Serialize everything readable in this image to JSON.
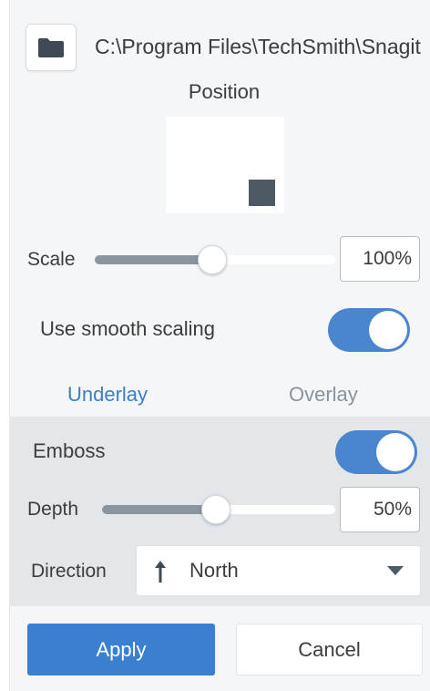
{
  "path": {
    "text": "C:\\Program Files\\TechSmith\\Snagit",
    "icon": "folder-icon"
  },
  "position": {
    "label": "Position",
    "selected": "bottom-right"
  },
  "scale": {
    "label": "Scale",
    "value_text": "100%",
    "slider_fraction": 0.5
  },
  "smooth_scaling": {
    "label": "Use smooth scaling",
    "on": true
  },
  "tabs": [
    {
      "label": "Underlay",
      "active": true
    },
    {
      "label": "Overlay",
      "active": false
    }
  ],
  "emboss": {
    "label": "Emboss",
    "on": true
  },
  "depth": {
    "label": "Depth",
    "value_text": "50%",
    "slider_fraction": 0.5
  },
  "direction": {
    "label": "Direction",
    "value": "North",
    "icon": "arrow-up-icon"
  },
  "buttons": {
    "apply": "Apply",
    "cancel": "Cancel"
  },
  "colors": {
    "accent": "#3a7fd0",
    "toggle_on": "#4a86cf",
    "active_tab": "#3d7fc7"
  }
}
